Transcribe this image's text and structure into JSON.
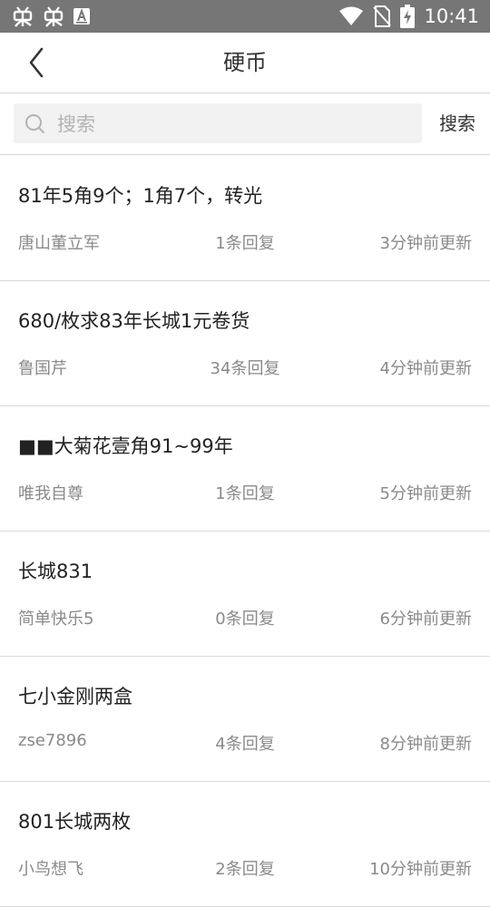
{
  "status_bar": {
    "time": "10:41",
    "left_icons": [
      "insect-app-icon",
      "insect-app-icon",
      "font-app-icon"
    ],
    "right_icons": [
      "wifi-icon",
      "no-sim-icon",
      "battery-charging-icon"
    ]
  },
  "nav": {
    "back_icon": "chevron-left-icon",
    "title": "硬币"
  },
  "search": {
    "placeholder": "搜索",
    "value": "",
    "button_label": "搜索"
  },
  "posts": [
    {
      "title": "81年5角9个；1角7个，转光",
      "author": "唐山董立军",
      "replies": "1条回复",
      "updated": "3分钟前更新"
    },
    {
      "title": "680/枚求83年长城1元卷货",
      "author": "鲁国芹",
      "replies": "34条回复",
      "updated": "4分钟前更新"
    },
    {
      "title": "■■大菊花壹角91~99年",
      "author": "唯我自尊",
      "replies": "1条回复",
      "updated": "5分钟前更新"
    },
    {
      "title": "长城831",
      "author": "简单快乐5",
      "replies": "0条回复",
      "updated": "6分钟前更新"
    },
    {
      "title": "七小金刚两盒",
      "author": "zse7896",
      "replies": "4条回复",
      "updated": "8分钟前更新"
    },
    {
      "title": "801长城两枚",
      "author": "小鸟想飞",
      "replies": "2条回复",
      "updated": "10分钟前更新"
    }
  ],
  "colors": {
    "status_bar_bg": "#767676",
    "divider": "#d9d9d9",
    "search_bg": "#f2f2f2",
    "meta_text": "#8a8a8a"
  }
}
